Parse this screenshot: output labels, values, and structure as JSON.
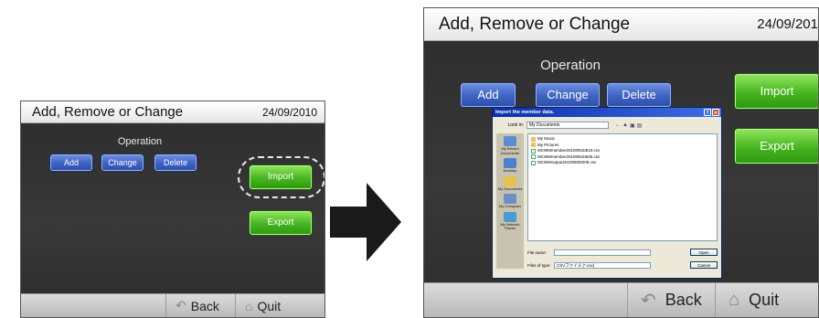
{
  "screen": {
    "title": "Add, Remove or Change",
    "date": "24/09/2010",
    "date_truncated": "24/09/201",
    "operation_label": "Operation",
    "buttons": {
      "add": "Add",
      "change": "Change",
      "delete": "Delete",
      "import": "Import",
      "export": "Export"
    },
    "nav": {
      "back": "Back",
      "quit": "Quit"
    }
  },
  "dialog": {
    "title": "Import the member data.",
    "look_in_label": "Look in:",
    "look_in_value": "My Documents",
    "places": [
      "My Recent Documents",
      "Desktop",
      "My Documents",
      "My Computer",
      "My Network Places"
    ],
    "files": [
      {
        "name": "My Music",
        "kind": "folder"
      },
      {
        "name": "My Pictures",
        "kind": "folder"
      },
      {
        "name": "MCWMmember20100915I610.csv",
        "kind": "file"
      },
      {
        "name": "MCWMmember20100915I625.csv",
        "kind": "file"
      },
      {
        "name": "MCWMoutput20100909I209.csv",
        "kind": "file"
      }
    ],
    "file_name_label": "File name:",
    "file_name_value": "",
    "files_of_type_label": "Files of type:",
    "files_of_type_value": "CSVファイル (*.csv)",
    "open_label": "Open",
    "cancel_label": "Cancel"
  },
  "colors": {
    "blue_button": "#3d62c2",
    "green_button": "#46b51f",
    "panel": "#333333",
    "arrow": "#1a1a1a"
  },
  "icons": {
    "back": "back-arrow-icon",
    "quit": "house-icon",
    "flow_arrow": "right-arrow-icon"
  }
}
